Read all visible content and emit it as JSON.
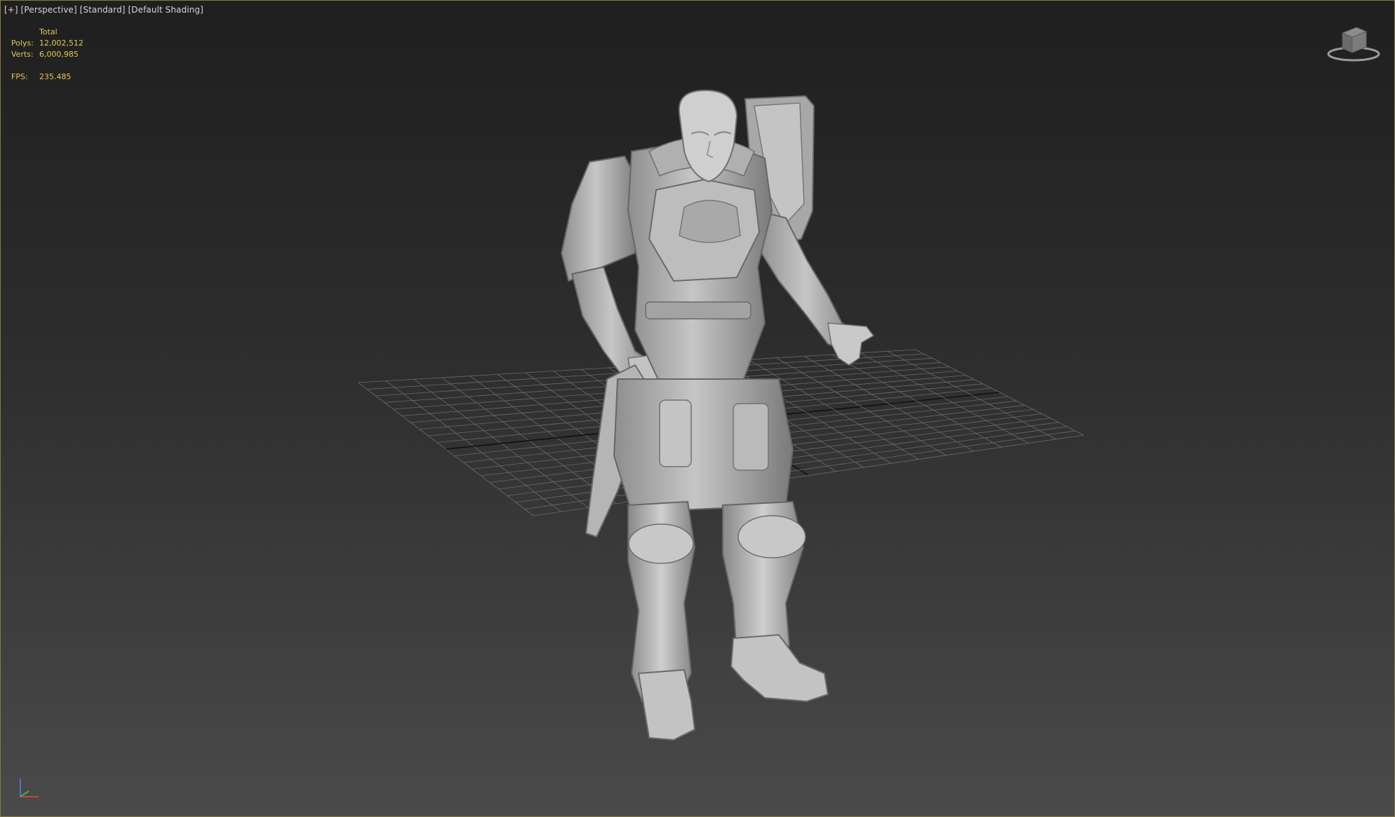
{
  "viewport": {
    "labels": {
      "plus": "[+]",
      "view": "[Perspective]",
      "visual_style": "[Standard]",
      "shading": "[Default Shading]"
    },
    "stats": {
      "header": "Total",
      "polys_label": "Polys:",
      "polys_value": "12,002,512",
      "verts_label": "Verts:",
      "verts_value": "6,000,985",
      "fps_label": "FPS:",
      "fps_value": "235.485"
    }
  },
  "colors": {
    "stats_text": "#e3c85a",
    "label_text": "#d6d6d6",
    "viewport_border": "#8a7a3a",
    "model_gray": "#bcbcbc",
    "grid_line": "#6a6a6a",
    "grid_axis": "#101010"
  },
  "icons": {
    "viewcube": "viewcube-icon",
    "axis": "axis-tripod-icon"
  }
}
